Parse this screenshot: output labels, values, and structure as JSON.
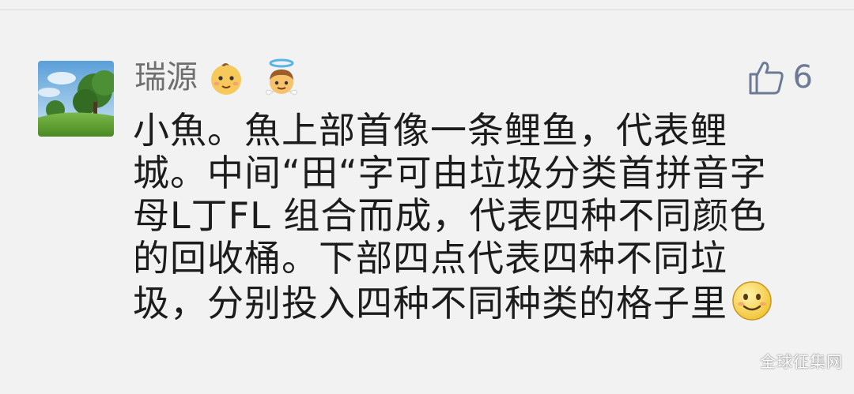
{
  "comment": {
    "username": "瑞源",
    "user_badges": [
      "baby-face-icon",
      "angel-face-icon"
    ],
    "like_count": "6",
    "text_lines": [
      "小魚。魚上部首像一条鲤鱼，代表鲤",
      "城。中间“田“字可由垃圾分类首拼音字",
      "母L丁FL 组合而成，代表四种不同颜色",
      "的回收桶。下部四点代表四种不同垃",
      "圾，分别投入四种不同种类的格子里"
    ],
    "trailing_emoji": "smile-face-icon"
  },
  "watermark": "全球征集网",
  "colors": {
    "background": "#f2f2f2",
    "username": "#6f6f6f",
    "like_accent": "#6c7a96",
    "body_text": "#1c1c1c"
  }
}
